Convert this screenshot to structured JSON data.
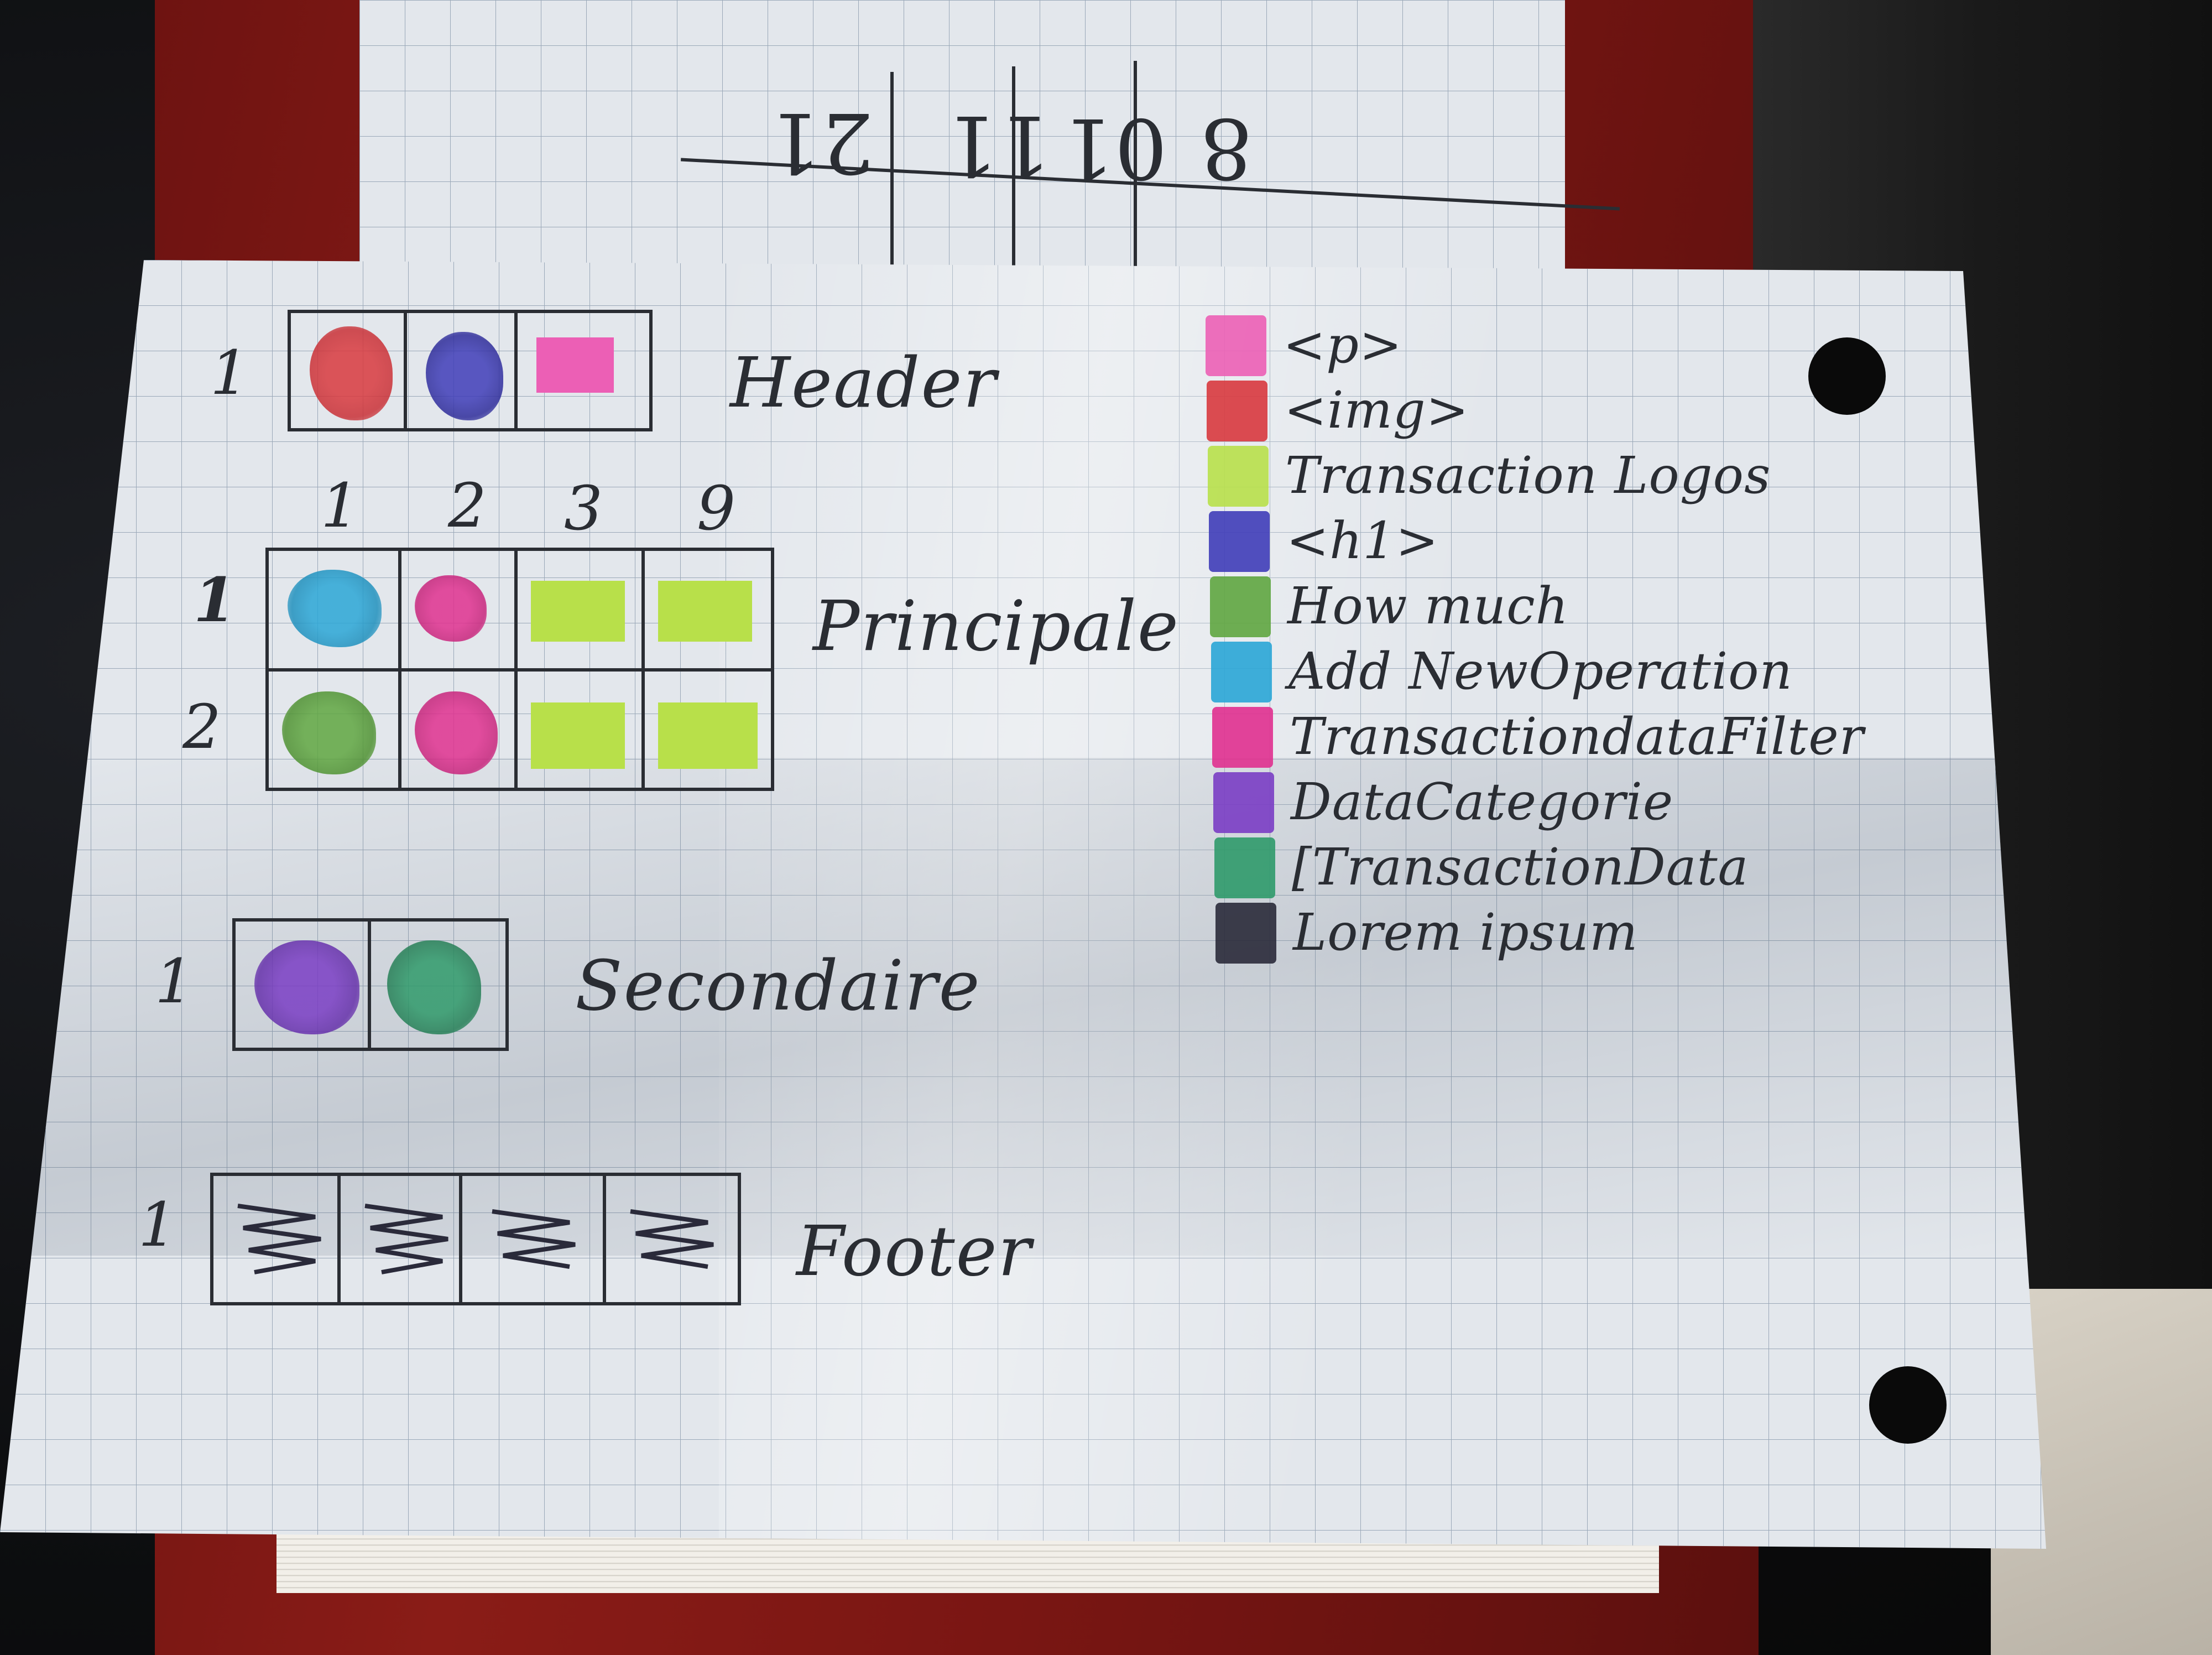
{
  "back_card": {
    "numbers": [
      "21",
      "11",
      "01",
      "8"
    ]
  },
  "layout": {
    "header": {
      "label": "Header",
      "row": "1"
    },
    "principale": {
      "label": "Principale",
      "columns": [
        "1",
        "2",
        "3",
        "9"
      ],
      "rows": [
        "1",
        "2"
      ]
    },
    "secondaire": {
      "label": "Secondaire",
      "row": "1"
    },
    "footer": {
      "label": "Footer",
      "row": "1"
    }
  },
  "legend": [
    {
      "label": "<p>",
      "color": "#ec5fb5"
    },
    {
      "label": "<img>",
      "color": "#d8393e"
    },
    {
      "label": "Transaction Logos",
      "color": "#b8e04a"
    },
    {
      "label": "<h1>",
      "color": "#3f3db8"
    },
    {
      "label": "How much",
      "color": "#5fa640"
    },
    {
      "label": "Add NewOperation",
      "color": "#2aa6d6"
    },
    {
      "label": "TransactiondataFilter",
      "color": "#e0308f"
    },
    {
      "label": "DataCategorie",
      "color": "#7a3dc4"
    },
    {
      "label": "[TransactionData",
      "color": "#2f9a6a"
    },
    {
      "label": "Lorem ipsum",
      "color": "#2a2a3a"
    }
  ]
}
